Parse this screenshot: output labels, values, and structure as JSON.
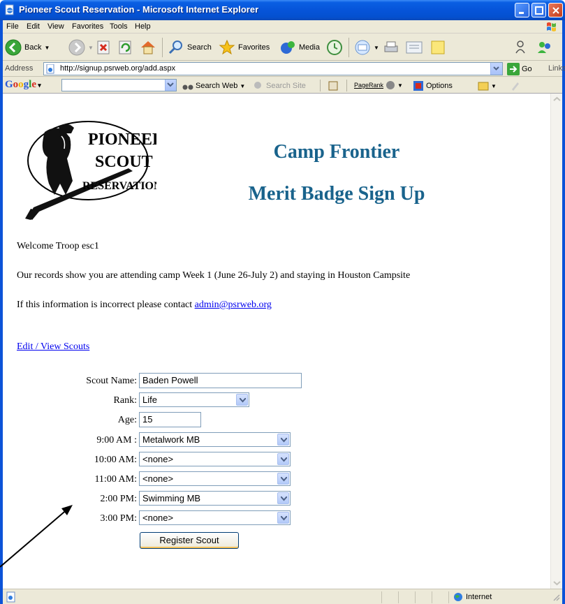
{
  "window": {
    "title": "Pioneer Scout Reservation - Microsoft Internet Explorer"
  },
  "menu": {
    "items": [
      {
        "label": "File"
      },
      {
        "label": "Edit"
      },
      {
        "label": "View"
      },
      {
        "label": "Favorites"
      },
      {
        "label": "Tools"
      },
      {
        "label": "Help"
      }
    ]
  },
  "toolbar": {
    "back_label": "Back",
    "search_label": "Search",
    "favorites_label": "Favorites",
    "media_label": "Media"
  },
  "address": {
    "label": "Address",
    "url": "http://signup.psrweb.org/add.aspx",
    "go_label": "Go",
    "links_label": "Links"
  },
  "google_bar": {
    "logo": "Google",
    "search_web_label": "Search Web",
    "search_site_label": "Search Site",
    "pagerank_label": "PageRank",
    "options_label": "Options"
  },
  "page": {
    "heading1": "Camp Frontier",
    "heading2": "Merit Badge Sign Up",
    "logo_lines": [
      "PIONEER",
      "SCOUT",
      "RESERVATION"
    ],
    "welcome": "Welcome Troop esc1",
    "records": "Our records show you are attending camp Week 1 (June 26-July 2) and staying in Houston Campsite",
    "incorrect_prefix": "If this information is incorrect please contact ",
    "contact_email": "admin@psrweb.org",
    "edit_link": "Edit / View Scouts"
  },
  "form": {
    "scout_name_label": "Scout Name:",
    "scout_name_value": "Baden Powell",
    "rank_label": "Rank:",
    "rank_value": "Life",
    "age_label": "Age:",
    "age_value": "15",
    "slots": [
      {
        "label": "9:00 AM :",
        "value": "Metalwork MB"
      },
      {
        "label": "10:00 AM:",
        "value": "<none>"
      },
      {
        "label": "11:00 AM:",
        "value": "<none>"
      },
      {
        "label": "2:00 PM:",
        "value": "Swimming MB"
      },
      {
        "label": "3:00 PM:",
        "value": "<none>"
      }
    ],
    "register_label": "Register Scout"
  },
  "status": {
    "zone_label": "Internet"
  },
  "colors": {
    "heading": "#19638c",
    "link": "#0000ee",
    "titlebar": "#0654d9"
  }
}
